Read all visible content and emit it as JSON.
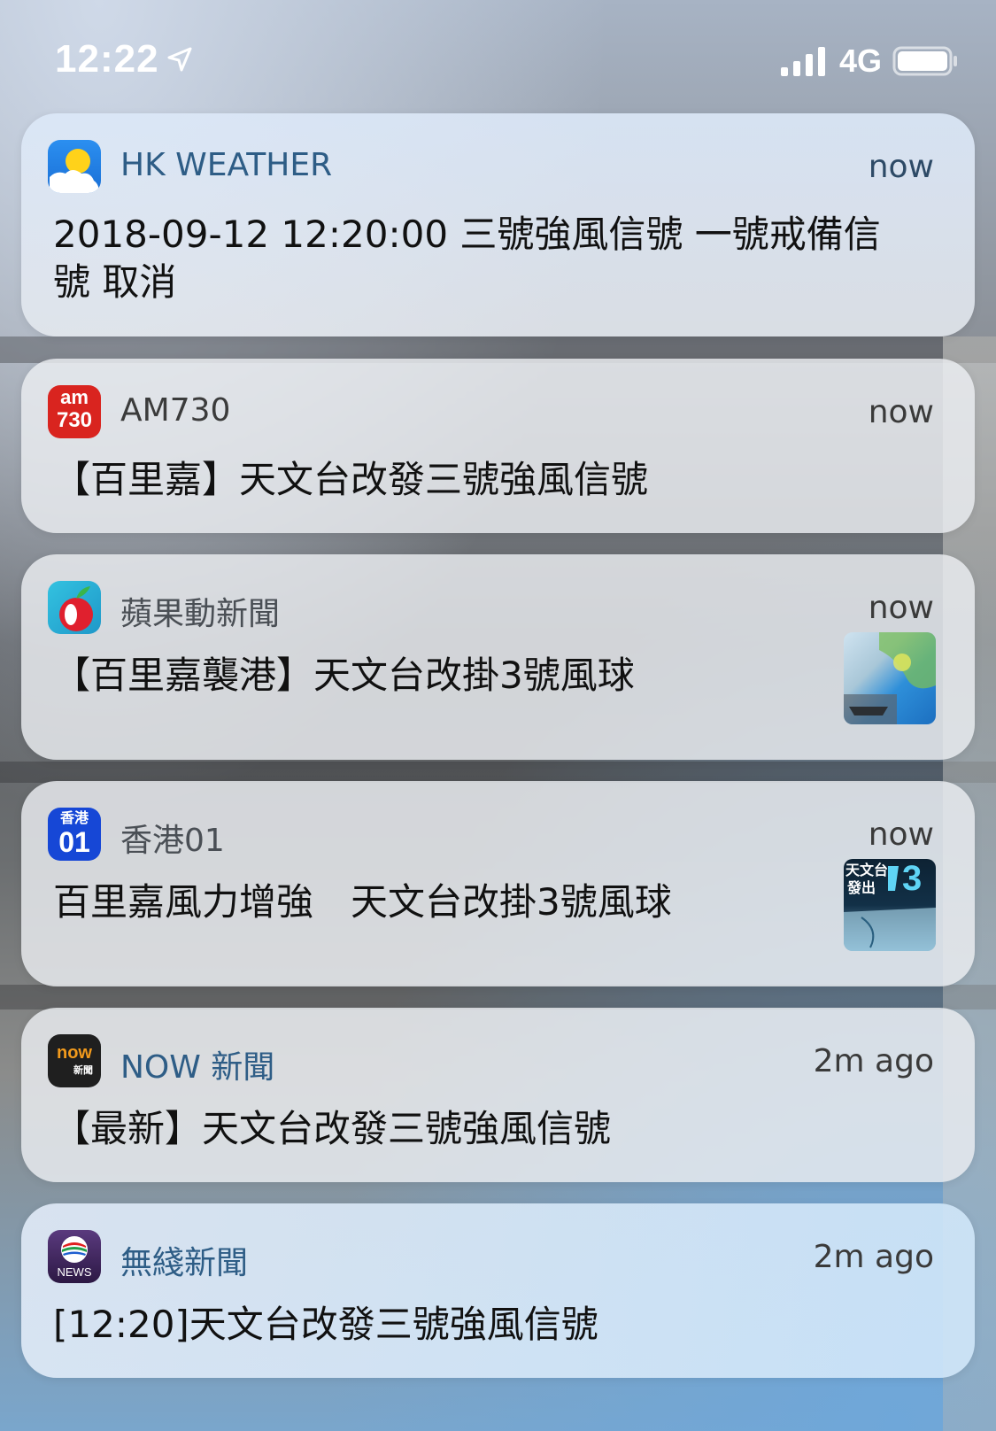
{
  "status_bar": {
    "time": "12:22",
    "network": "4G",
    "icons": [
      "location-arrow-icon",
      "cellular-signal-icon",
      "battery-icon"
    ]
  },
  "notifications": [
    {
      "app": "HK WEATHER",
      "time": "now",
      "body": "2018-09-12 12:20:00 三號強風信號 一號戒備信號 取消",
      "icon": "hk-weather-app-icon"
    },
    {
      "app": "AM730",
      "time": "now",
      "body": "【百里嘉】天文台改發三號強風信號",
      "icon": "am730-app-icon",
      "icon_text": [
        "am",
        "730"
      ]
    },
    {
      "app": "蘋果動新聞",
      "time": "now",
      "body": "【百里嘉襲港】天文台改掛3號風球",
      "icon": "apple-news-app-icon",
      "thumbnail": "typhoon-map-thumbnail"
    },
    {
      "app": "香港01",
      "time": "now",
      "body": "百里嘉風力增強　天文台改掛3號風球",
      "icon": "hk01-app-icon",
      "icon_text": [
        "香港",
        "01"
      ],
      "thumbnail": "observatory-signal-thumbnail",
      "thumbnail_text": [
        "天文台",
        "發出",
        "3"
      ]
    },
    {
      "app": "NOW 新聞",
      "time": "2m ago",
      "body": "【最新】天文台改發三號強風信號",
      "icon": "now-news-app-icon",
      "icon_text": [
        "now",
        "新聞"
      ]
    },
    {
      "app": "無綫新聞",
      "time": "2m ago",
      "body": "[12:20]天文台改發三號強風信號",
      "icon": "tvb-news-app-icon",
      "icon_text": [
        "NEWS"
      ]
    }
  ],
  "colors": {
    "app_name_blue": "#2e5d86",
    "am730_red": "#d9241f",
    "apple_red": "#e0202e",
    "hk01_blue": "#1647d6",
    "tvb_purple": "#4a2a6a"
  }
}
